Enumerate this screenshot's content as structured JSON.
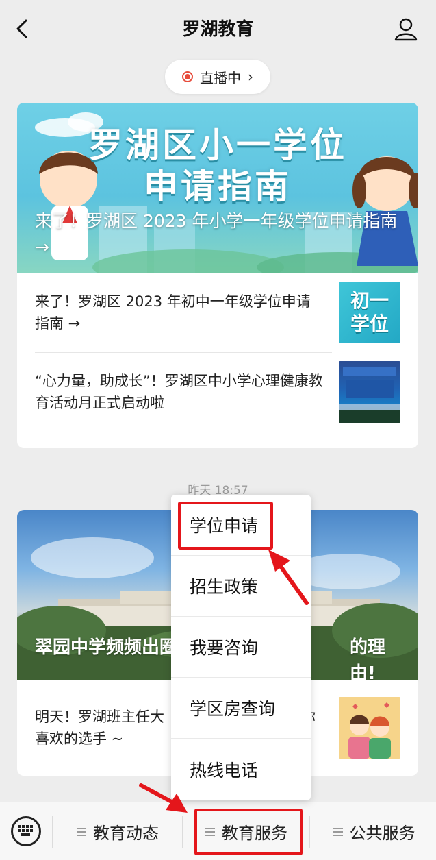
{
  "header": {
    "title": "罗湖教育",
    "back_icon": "chevron-left-icon",
    "profile_icon": "person-icon"
  },
  "live": {
    "label": "直播中",
    "chevron": "›"
  },
  "article_group_1": {
    "banner": {
      "headline_line1": "罗湖区小一学位",
      "headline_line2": "申请指南",
      "caption": "来了！罗湖区 2023 年小学一年级学位申请指南 →"
    },
    "items": [
      {
        "text": "来了！罗湖区 2023 年初中一年级学位申请指南 →",
        "thumb_text": "初一学位"
      },
      {
        "text": "“心力量，助成长”！罗湖区中小学心理健康教育活动月正式启动啦"
      }
    ]
  },
  "timestamp": "昨天 18:57",
  "article_group_2": {
    "banner": {
      "caption_left": "翠园中学频频出圈",
      "caption_right": "的理由!"
    },
    "items": [
      {
        "text_line1_left": "明天！罗湖班主任大",
        "text_line1_right": "你",
        "text_line2": "喜欢的选手 ~"
      }
    ]
  },
  "popup_menu": {
    "items": [
      "学位申请",
      "招生政策",
      "我要咨询",
      "学区房查询",
      "热线电话"
    ]
  },
  "bottom_menu": {
    "keyboard_icon": "keyboard-icon",
    "items": [
      "教育动态",
      "教育服务",
      "公共服务"
    ]
  },
  "colors": {
    "highlight": "#e4161b",
    "live_red": "#e74c3c",
    "background": "#ededed"
  }
}
